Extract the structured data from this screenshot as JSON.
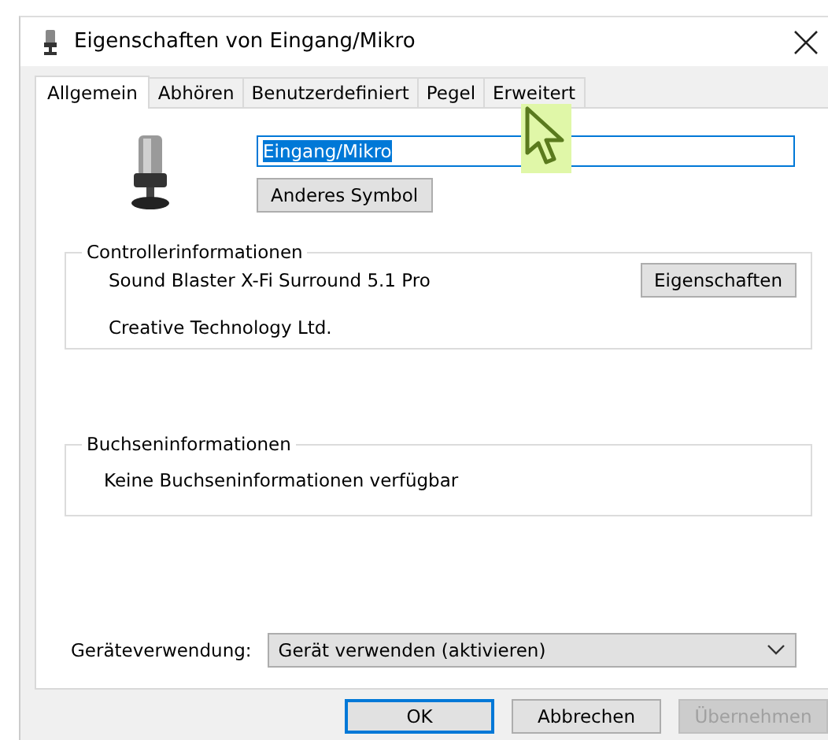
{
  "window": {
    "title": "Eigenschaften von Eingang/Mikro"
  },
  "tabs": [
    {
      "label": "Allgemein",
      "selected": true
    },
    {
      "label": "Abhören",
      "selected": false
    },
    {
      "label": "Benutzerdefiniert",
      "selected": false
    },
    {
      "label": "Pegel",
      "selected": false
    },
    {
      "label": "Erweitert",
      "selected": false
    }
  ],
  "name_field": {
    "value": "Eingang/Mikro",
    "text_selected": true
  },
  "change_icon_button": "Anderes Symbol",
  "controller_group": {
    "title": "Controllerinformationen",
    "device": "Sound Blaster X-Fi Surround 5.1 Pro",
    "vendor": "Creative Technology Ltd.",
    "button": "Eigenschaften"
  },
  "jack_group": {
    "title": "Buchseninformationen",
    "text": "Keine Buchseninformationen verfügbar"
  },
  "device_usage": {
    "label": "Geräteverwendung:",
    "value": "Gerät verwenden (aktivieren)"
  },
  "buttons": [
    {
      "label": "OK",
      "kind": "default",
      "disabled": false
    },
    {
      "label": "Abbrechen",
      "kind": "normal",
      "disabled": false
    },
    {
      "label": "Übernehmen",
      "kind": "normal",
      "disabled": true
    }
  ]
}
